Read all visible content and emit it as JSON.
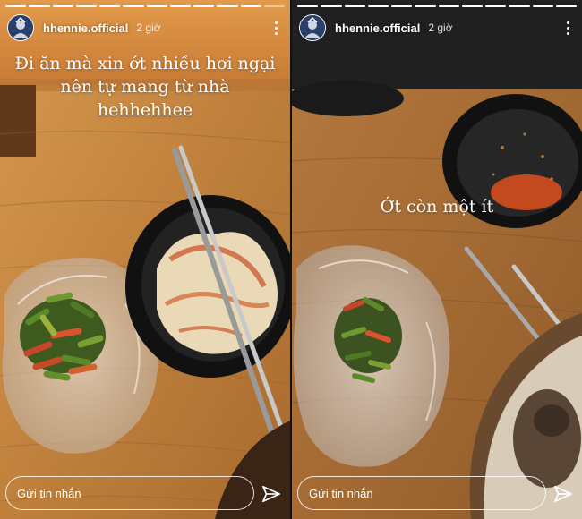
{
  "stories": [
    {
      "username": "hhennie.official",
      "time_ago": "2 giờ",
      "caption": "Đi ăn mà xin ớt nhiều  hơi ngại nên tự mang từ nhà hehhehhee",
      "reply_placeholder": "Gửi tin nhắn",
      "progress_total": 12,
      "progress_done": 11,
      "icons": {
        "more": "more-vertical-icon",
        "send": "send-icon",
        "avatar": "avatar"
      }
    },
    {
      "username": "hhennie.official",
      "time_ago": "2 giờ",
      "caption": "Ớt còn một ít",
      "reply_placeholder": "Gửi tin nhắn",
      "progress_total": 12,
      "progress_done": 12,
      "icons": {
        "more": "more-vertical-icon",
        "send": "send-icon",
        "avatar": "avatar"
      }
    }
  ],
  "colors": {
    "table_wood": "#c48a44",
    "top_bar_left": "#d9893e",
    "top_bar_right": "#1f1f1f"
  }
}
